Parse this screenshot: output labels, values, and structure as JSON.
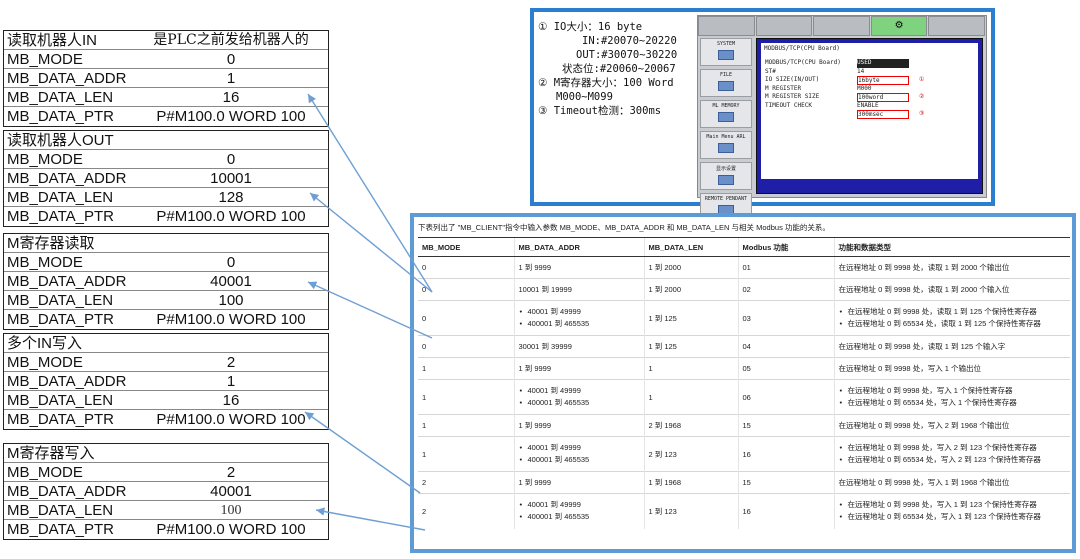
{
  "tables": [
    {
      "title_key": "读取机器人IN",
      "title_val": "是PLC之前发给机器人的",
      "rows": [
        [
          "MB_MODE",
          "0"
        ],
        [
          "MB_DATA_ADDR",
          "1"
        ],
        [
          "MB_DATA_LEN",
          "16"
        ],
        [
          "MB_DATA_PTR",
          "P#M100.0 WORD 100"
        ]
      ]
    },
    {
      "title_key": "读取机器人OUT",
      "title_val": "",
      "rows": [
        [
          "MB_MODE",
          "0"
        ],
        [
          "MB_DATA_ADDR",
          "10001"
        ],
        [
          "MB_DATA_LEN",
          "128"
        ],
        [
          "MB_DATA_PTR",
          "P#M100.0 WORD 100"
        ]
      ]
    },
    {
      "title_key": "M寄存器读取",
      "title_val": "",
      "rows": [
        [
          "MB_MODE",
          "0"
        ],
        [
          "MB_DATA_ADDR",
          "40001"
        ],
        [
          "MB_DATA_LEN",
          "100"
        ],
        [
          "MB_DATA_PTR",
          "P#M100.0 WORD 100"
        ]
      ]
    },
    {
      "title_key": "多个IN写入",
      "title_val": "",
      "rows": [
        [
          "MB_MODE",
          "2"
        ],
        [
          "MB_DATA_ADDR",
          "1"
        ],
        [
          "MB_DATA_LEN",
          "16"
        ],
        [
          "MB_DATA_PTR",
          "P#M100.0 WORD 100"
        ]
      ]
    },
    {
      "title_key": "M寄存器写入",
      "title_val": "",
      "rows": [
        [
          "MB_MODE",
          "2"
        ],
        [
          "MB_DATA_ADDR",
          "40001"
        ],
        [
          "MB_DATA_LEN",
          "100"
        ],
        [
          "MB_DATA_PTR",
          "P#M100.0 WORD 100"
        ]
      ]
    }
  ],
  "hmi_notes": {
    "line1": "① IO大小：16 byte",
    "line2": "IN:#20070~20220",
    "line3": "OUT:#30070~30220",
    "line4": "状态位:#20060~20067",
    "line5": "② M寄存器大小：100 Word",
    "line6": "M000~M099",
    "line7": "③ Timeout检测：300ms"
  },
  "pendant": {
    "tab_icon": "⚙",
    "side_buttons": [
      "SYSTEM",
      "FILE",
      "ML MEMORY",
      "Main Menu ARL",
      "显示设置",
      "REMOTE PENDANT"
    ],
    "screen_title": "MODBUS/TCP(CPU Board)",
    "lines": [
      {
        "a": "MODBUS/TCP(CPU Board)",
        "b": "USED",
        "c": ""
      },
      {
        "a": "ST#",
        "b": "14",
        "c": ""
      },
      {
        "a": "IO SIZE(IN/OUT)",
        "b": "16byte",
        "c": "①"
      },
      {
        "a": "M REGISTER",
        "b": "M000",
        "c": ""
      },
      {
        "a": "M REGISTER SIZE",
        "b": "100word",
        "c": "②"
      },
      {
        "a": "TIMEOUT CHECK",
        "b": "ENABLE",
        "c": ""
      },
      {
        "a": "",
        "b": "300msec",
        "c": "③"
      }
    ]
  },
  "reference": {
    "intro": "下表列出了 \"MB_CLIENT\"指令中输入参数 MB_MODE、MB_DATA_ADDR 和 MB_DATA_LEN 与相关 Modbus 功能的关系。",
    "headers": [
      "MB_MODE",
      "MB_DATA_ADDR",
      "MB_DATA_LEN",
      "Modbus 功能",
      "功能和数据类型"
    ],
    "rows": [
      {
        "mode": "0",
        "addr": [
          "1 到 9999"
        ],
        "len": "1 到 2000",
        "func": "01",
        "desc": [
          "在远程地址 0 到 9998 处，读取 1 到 2000 个输出位"
        ]
      },
      {
        "mode": "0",
        "addr": [
          "10001 到 19999"
        ],
        "len": "1 到 2000",
        "func": "02",
        "desc": [
          "在远程地址 0 到 9998 处，读取 1 到 2000 个输入位"
        ]
      },
      {
        "mode": "0",
        "addr": [
          "40001 到 49999",
          "400001 到 465535"
        ],
        "len": "1 到 125",
        "func": "03",
        "desc": [
          "在远程地址 0 到 9998 处，读取 1 到 125 个保持性寄存器",
          "在远程地址 0 到 65534 处，读取 1 到 125 个保持性寄存器"
        ]
      },
      {
        "mode": "0",
        "addr": [
          "30001 到 39999"
        ],
        "len": "1 到 125",
        "func": "04",
        "desc": [
          "在远程地址 0 到 9998 处，读取 1 到 125 个输入字"
        ]
      },
      {
        "mode": "1",
        "addr": [
          "1 到 9999"
        ],
        "len": "1",
        "func": "05",
        "desc": [
          "在远程地址 0 到 9998 处，写入 1 个输出位"
        ]
      },
      {
        "mode": "1",
        "addr": [
          "40001 到 49999",
          "400001 到 465535"
        ],
        "len": "1",
        "func": "06",
        "desc": [
          "在远程地址 0 到 9998 处，写入 1 个保持性寄存器",
          "在远程地址 0 到 65534 处，写入 1 个保持性寄存器"
        ]
      },
      {
        "mode": "1",
        "addr": [
          "1 到 9999"
        ],
        "len": "2 到 1968",
        "func": "15",
        "desc": [
          "在远程地址 0 到 9998 处，写入 2 到 1968 个输出位"
        ]
      },
      {
        "mode": "1",
        "addr": [
          "40001 到 49999",
          "400001 到 465535"
        ],
        "len": "2 到 123",
        "func": "16",
        "desc": [
          "在远程地址 0 到 9998 处，写入 2 到 123 个保持性寄存器",
          "在远程地址 0 到 65534 处，写入 2 到 123 个保持性寄存器"
        ]
      },
      {
        "mode": "2",
        "addr": [
          "1 到 9999"
        ],
        "len": "1 到 1968",
        "func": "15",
        "desc": [
          "在远程地址 0 到 9998 处，写入 1 到 1968 个输出位"
        ]
      },
      {
        "mode": "2",
        "addr": [
          "40001 到 49999",
          "400001 到 465535"
        ],
        "len": "1 到 123",
        "func": "16",
        "desc": [
          "在远程地址 0 到 9998 处，写入 1 到 123 个保持性寄存器",
          "在远程地址 0 到 65534 处，写入 1 到 123 个保持性寄存器"
        ]
      }
    ]
  },
  "colors": {
    "panel_border": "#2a7fd0",
    "ref_border": "#5d9bd6",
    "arrow": "#6f9fd2",
    "pendant_screen": "#1e1fa6",
    "highlight_box": "#e00000"
  }
}
